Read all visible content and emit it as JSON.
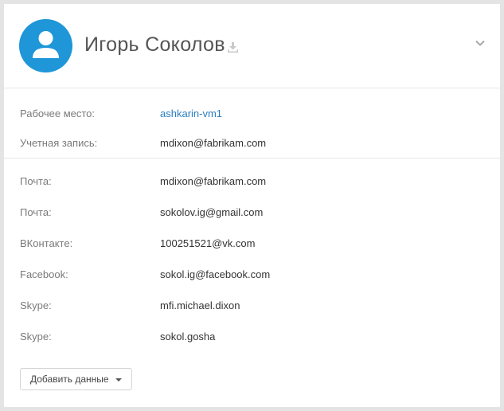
{
  "profile": {
    "name": "Игорь Соколов",
    "icons": {
      "avatar": "user-silhouette-icon",
      "download": "download-icon",
      "collapse": "chevron-down-icon"
    },
    "colors": {
      "avatar_bg": "#1e96d8",
      "link": "#2b7fc1"
    }
  },
  "work": [
    {
      "label": "Рабочее место:",
      "value": "ashkarin-vm1",
      "is_link": true
    },
    {
      "label": "Учетная запись:",
      "value": "mdixon@fabrikam.com",
      "is_link": false
    }
  ],
  "contacts": [
    {
      "label": "Почта:",
      "value": "mdixon@fabrikam.com"
    },
    {
      "label": "Почта:",
      "value": "sokolov.ig@gmail.com"
    },
    {
      "label": "ВКонтакте:",
      "value": "100251521@vk.com"
    },
    {
      "label": "Facebook:",
      "value": "sokol.ig@facebook.com"
    },
    {
      "label": "Skype:",
      "value": "mfi.michael.dixon"
    },
    {
      "label": "Skype:",
      "value": "sokol.gosha"
    }
  ],
  "actions": {
    "add_data_label": "Добавить данные"
  }
}
